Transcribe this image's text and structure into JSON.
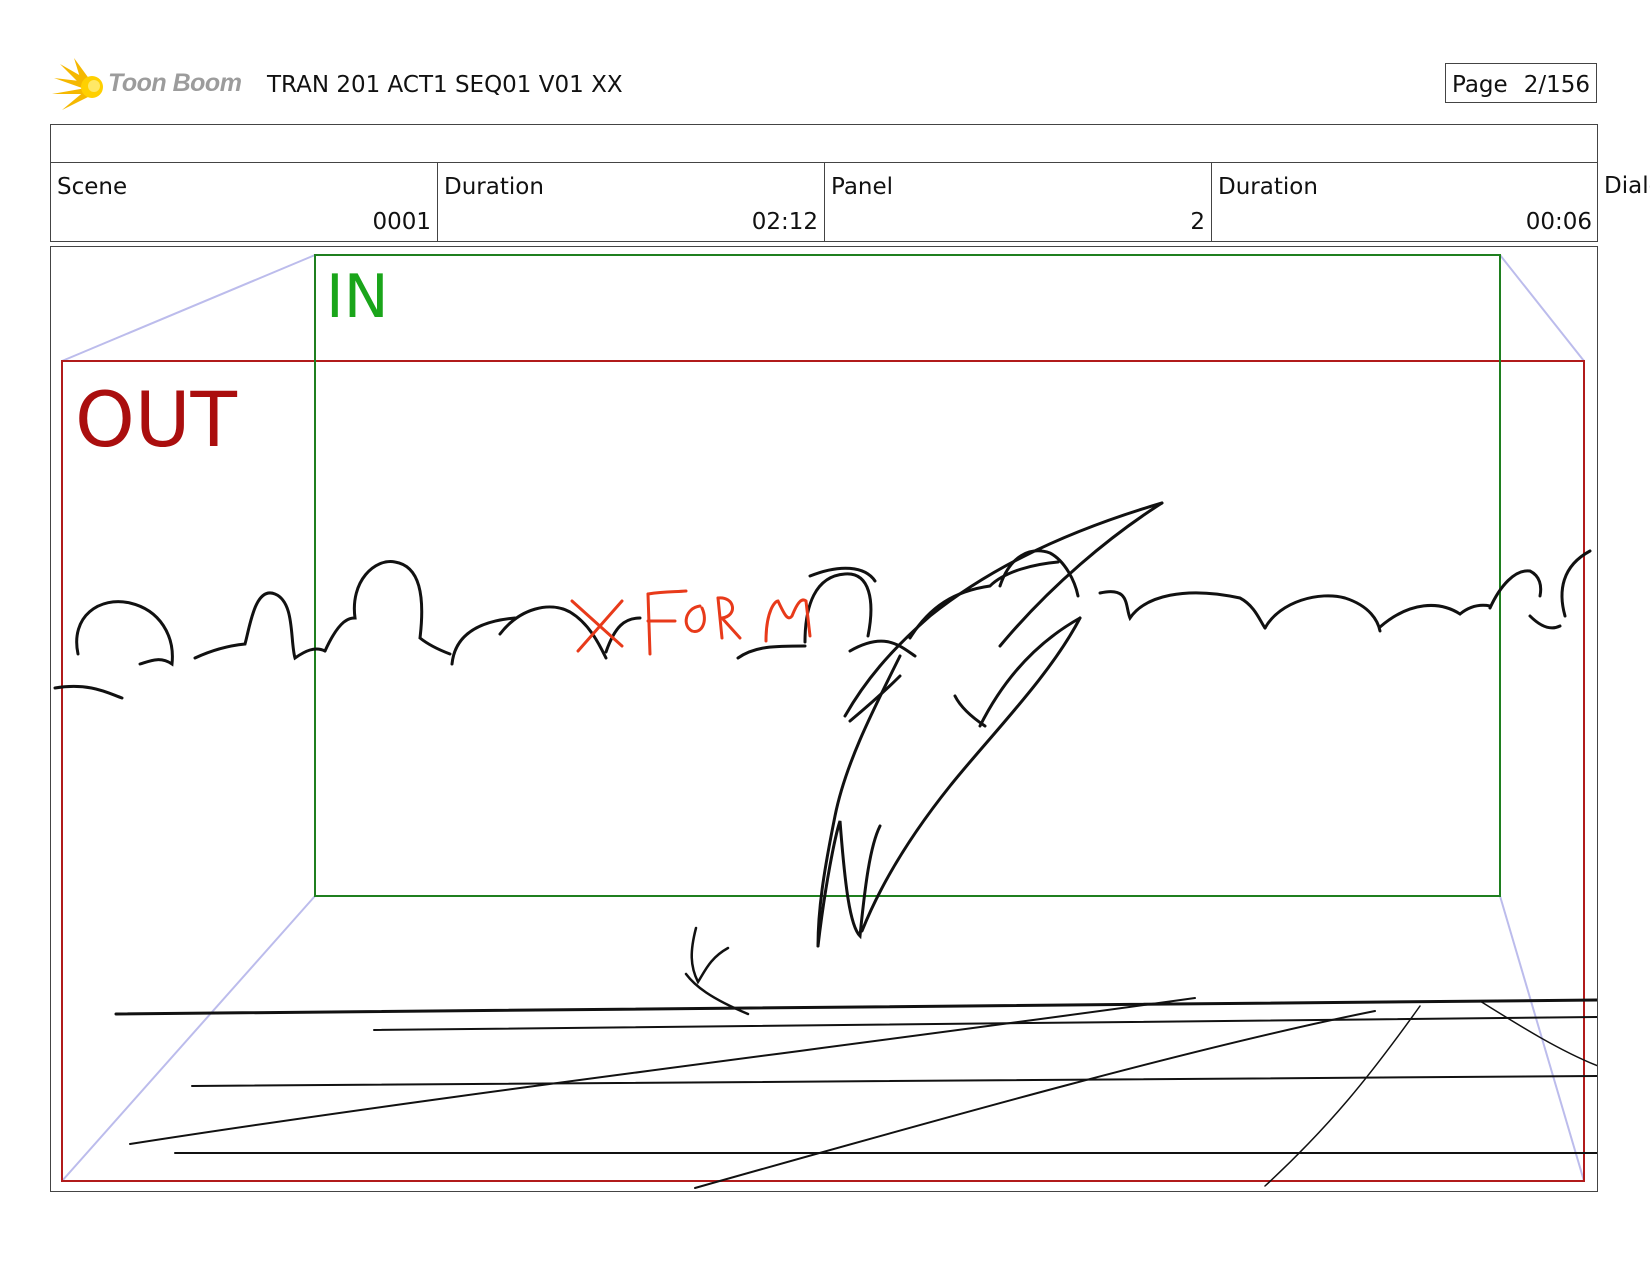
{
  "header": {
    "logo_text": "Toon Boom",
    "title": "TRAN 201 ACT1 SEQ01 V01 XX",
    "page_label": "Page",
    "page_value": "2/156"
  },
  "info": {
    "scene_label": "Scene",
    "scene_value": "0001",
    "scene_duration_label": "Duration",
    "scene_duration_value": "02:12",
    "panel_label": "Panel",
    "panel_value": "2",
    "panel_duration_label": "Duration",
    "panel_duration_value": "00:06",
    "dialog_label": "Dialo"
  },
  "panel": {
    "in_label": "IN",
    "out_label": "OUT",
    "sketch_note": "X FORM"
  },
  "colors": {
    "in_frame": "#1f7f1f",
    "out_frame": "#b11b1b",
    "perspective_lines": "#bcbcec",
    "sketch": "#111111",
    "note": "#e83a1a"
  },
  "icons": {
    "logo": "starburst-icon"
  }
}
